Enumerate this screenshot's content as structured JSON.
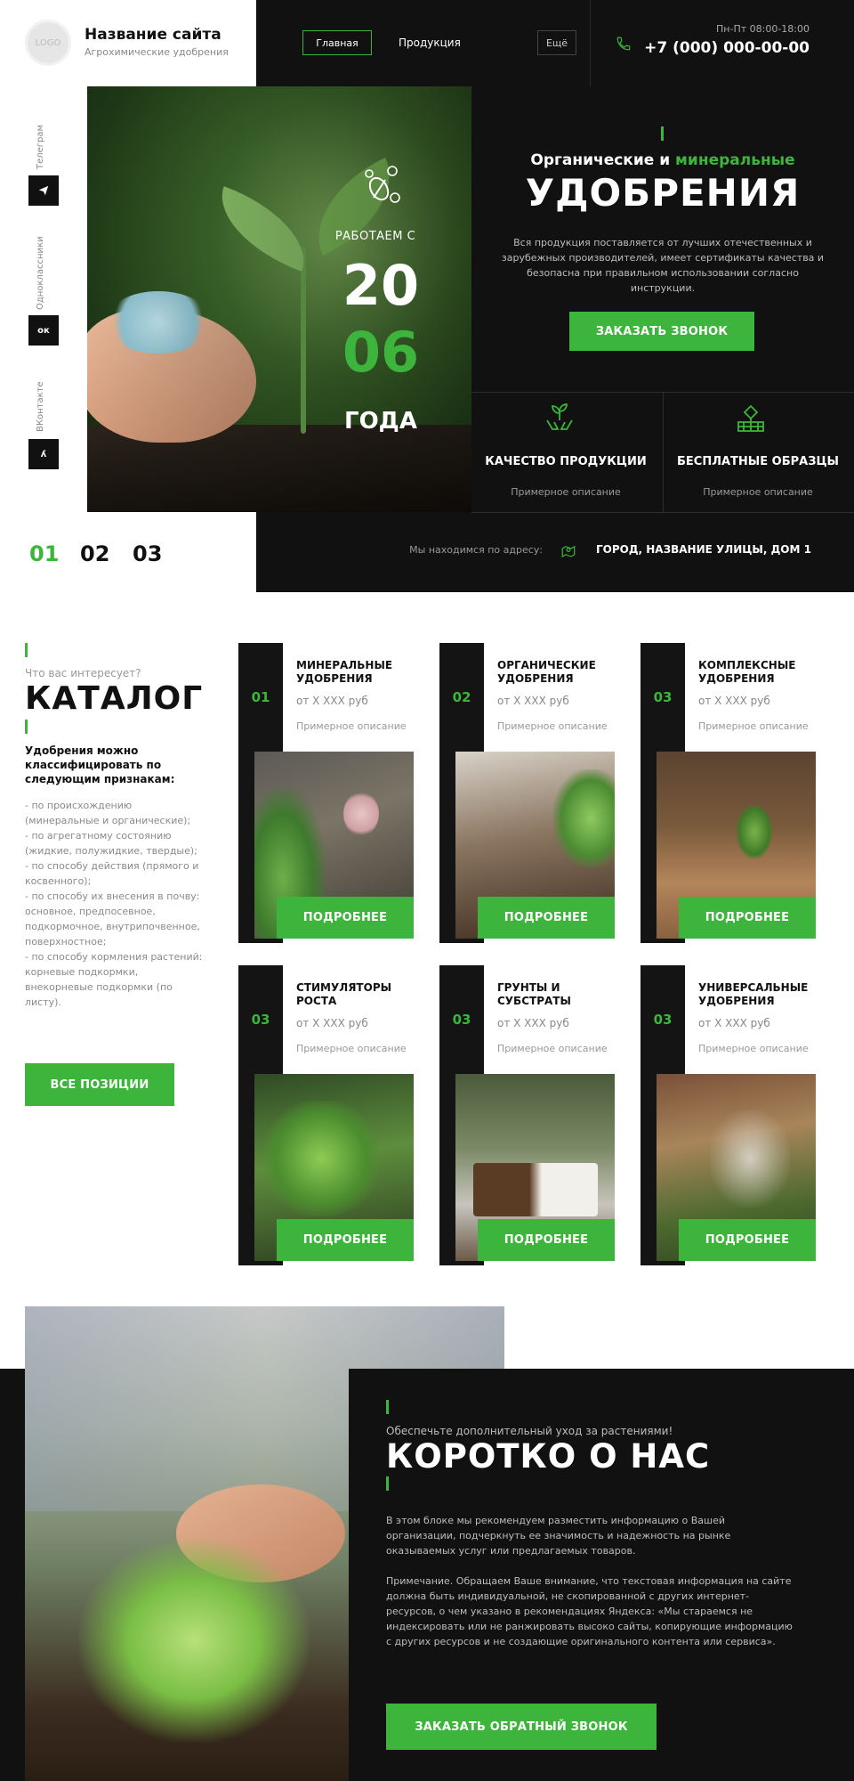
{
  "header": {
    "logo": "LOGO",
    "site_name": "Название сайта",
    "site_subtitle": "Агрохимические удобрения",
    "nav": [
      "Главная",
      "Продукция"
    ],
    "more": "Ещё",
    "hours": "Пн-Пт 08:00-18:00",
    "phone": "+7 (000) 000-00-00"
  },
  "social": [
    {
      "label": "Телеграм",
      "icon": "telegram-icon",
      "glyph": "➤"
    },
    {
      "label": "Одноклассники",
      "icon": "odnoklassniki-icon",
      "glyph": "ок"
    },
    {
      "label": "ВКонтакте",
      "icon": "vk-icon",
      "glyph": "ʎ"
    }
  ],
  "hero": {
    "work_since": "РАБОТАЕМ С",
    "year_top": "20",
    "year_bottom": "06",
    "year_word": "ГОДА",
    "title_white": "Органические и ",
    "title_green": "минеральные",
    "title_big": "УДОБРЕНИЯ",
    "description": "Вся продукция поставляется от лучших отечественных и зарубежных производителей, имеет сертификаты качества и безопасна при правильном использовании согласно инструкции.",
    "cta": "ЗАКАЗАТЬ ЗВОНОК",
    "features": [
      {
        "title": "КАЧЕСТВО ПРОДУКЦИИ",
        "desc": "Примерное описание",
        "icon": "hands-plant-icon"
      },
      {
        "title": "БЕСПЛАТНЫЕ ОБРАЗЦЫ",
        "desc": "Примерное описание",
        "icon": "soil-sample-icon"
      }
    ],
    "address_label": "Мы находимся по адресу:",
    "address": "ГОРОД, НАЗВАНИЕ УЛИЦЫ, ДОМ 1"
  },
  "slider": {
    "numbers": [
      "01",
      "02",
      "03"
    ],
    "active": 0
  },
  "catalog": {
    "question": "Что вас интересует?",
    "title": "КАТАЛОГ",
    "subhead": "Удобрения можно классифицировать по следующим признакам:",
    "list": "- по происхождению (минеральные и органические);\n- по агрегатному состоянию (жидкие, полужидкие, твердые);\n- по способу действия (прямого и косвенного);\n- по способу их внесения в почву:\nосновное, предпосевное, подкормочное, внутрипочвенное, поверхностное;\n- по способу кормления растений: корневые подкормки, внекорневые подкормки (по листу).",
    "all_button": "ВСЕ ПОЗИЦИИ",
    "cards": [
      {
        "num": "01",
        "title": "МИНЕРАЛЬНЫЕ УДОБРЕНИЯ",
        "price": "от Х ХХХ руб",
        "desc": "Примерное описание",
        "button": "ПОДРОБНЕЕ"
      },
      {
        "num": "02",
        "title": "ОРГАНИЧЕСКИЕ УДОБРЕНИЯ",
        "price": "от Х ХХХ руб",
        "desc": "Примерное описание",
        "button": "ПОДРОБНЕЕ"
      },
      {
        "num": "03",
        "title": "КОМПЛЕКСНЫЕ УДОБРЕНИЯ",
        "price": "от Х ХХХ руб",
        "desc": "Примерное описание",
        "button": "ПОДРОБНЕЕ"
      },
      {
        "num": "03",
        "title": "СТИМУЛЯТОРЫ РОСТА",
        "price": "от Х ХХХ руб",
        "desc": "Примерное описание",
        "button": "ПОДРОБНЕЕ"
      },
      {
        "num": "03",
        "title": "ГРУНТЫ И СУБСТРАТЫ",
        "price": "от Х ХХХ руб",
        "desc": "Примерное описание",
        "button": "ПОДРОБНЕЕ"
      },
      {
        "num": "03",
        "title": "УНИВЕРСАЛЬНЫЕ УДОБРЕНИЯ",
        "price": "от Х ХХХ руб",
        "desc": "Примерное описание",
        "button": "ПОДРОБНЕЕ"
      }
    ]
  },
  "about": {
    "kicker": "Обеспечьте дополнительный уход за растениями!",
    "title": "КОРОТКО О НАС",
    "p1": "В этом блоке мы рекомендуем разместить информацию о Вашей организации, подчеркнуть ее значимость и надежность на рынке оказываемых услуг или предлагаемых товаров.",
    "p2": "Примечание. Обращаем Ваше внимание, что текстовая информация на сайте должна быть индивидуальной, не скопированной с других интернет-ресурсов, о чем указано в рекомендациях Яндекса: «Мы стараемся не индексировать или не ранжировать высоко сайты, копирующие информацию с других ресурсов и не создающие оригинального контента или сервиса».",
    "cta": "ЗАКАЗАТЬ ОБРАТНЫЙ ЗВОНОК"
  },
  "colors": {
    "accent": "#3db43b",
    "dark": "#111111",
    "text_muted": "#8a8a8a"
  }
}
